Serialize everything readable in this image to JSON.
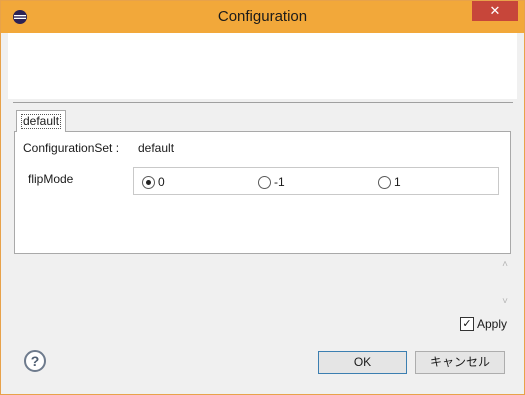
{
  "window": {
    "title": "Configuration",
    "close_glyph": "✕",
    "app_icon": "eclipse-icon"
  },
  "tabs": [
    {
      "label": "default",
      "selected": true
    }
  ],
  "panel": {
    "configuration_set_label": "ConfigurationSet :",
    "configuration_set_value": "default",
    "flip_mode_label": "flipMode",
    "flip_mode_options": [
      {
        "label": "0",
        "selected": true
      },
      {
        "label": "-1",
        "selected": false
      },
      {
        "label": "1",
        "selected": false
      }
    ]
  },
  "scroll": {
    "up_glyph": "˄",
    "down_glyph": "˅"
  },
  "apply": {
    "label": "Apply",
    "checked": true,
    "check_glyph": "✓"
  },
  "footer": {
    "help_glyph": "?",
    "ok_label": "OK",
    "cancel_label": "キャンセル"
  },
  "colors": {
    "titlebar": "#f2a83a",
    "close_button": "#c7463a"
  }
}
